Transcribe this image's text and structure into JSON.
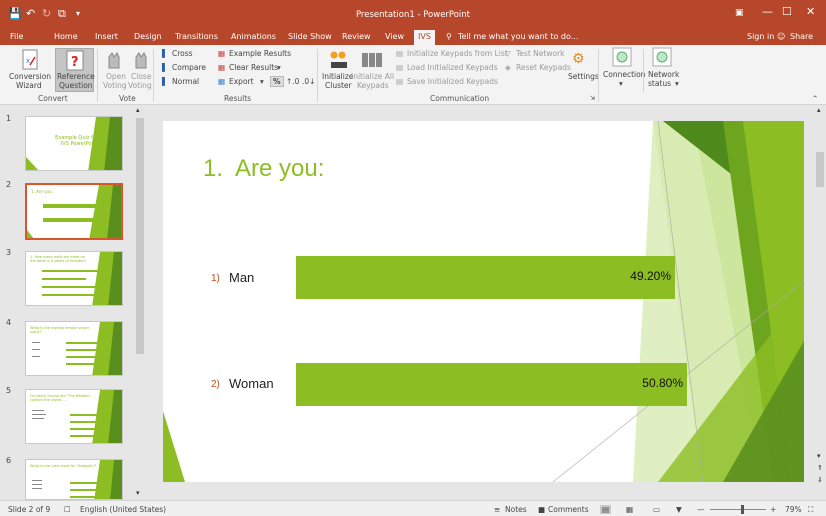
{
  "window": {
    "title": "Presentation1 - PowerPoint",
    "minimize": "—",
    "maximize": "☐",
    "close": "✕"
  },
  "quick_access": {
    "save_icon": "💾",
    "undo_icon": "↶",
    "redo_icon": "↻",
    "present_icon": "⧉",
    "customize_icon": "▾"
  },
  "tabs": [
    "File",
    "Home",
    "Insert",
    "Design",
    "Transitions",
    "Animations",
    "Slide Show",
    "Review",
    "View",
    "IVS"
  ],
  "tell_me": "Tell me what you want to do...",
  "account": {
    "sign_in": "Sign in",
    "share": "Share"
  },
  "ribbon": {
    "convert": {
      "group": "Convert",
      "conversion_wizard": [
        "Conversion",
        "Wizard"
      ],
      "reference_question": [
        "Reference",
        "Question"
      ]
    },
    "vote": {
      "group": "Vote",
      "open_voting": [
        "Open",
        "Voting"
      ],
      "close_voting": [
        "Close",
        "Voting"
      ]
    },
    "results": {
      "group": "Results",
      "cross": "Cross",
      "compare": "Compare",
      "normal": "Normal",
      "example_results": "Example Results",
      "clear_results": "Clear Results",
      "export": "Export",
      "percent": "%"
    },
    "communication": {
      "group": "Communication",
      "initialize_cluster": [
        "Initialize",
        "Cluster"
      ],
      "initialize_all_keypads": [
        "Initialize All",
        "Keypads"
      ],
      "init_keypads_from_list": "Initialize Keypads from List",
      "load_initialized_keypads": "Load Initialized Keypads",
      "save_initialized_keypads": "Save Initialized Keypads",
      "test_network": "Test Network",
      "reset_keypads": "Reset Keypads",
      "settings": "Settings"
    },
    "connection": {
      "connection": "Connection",
      "network_status": [
        "Network",
        "status"
      ]
    }
  },
  "thumbnails": [
    {
      "num": "1",
      "title": "Example Quiz for IVS PowerPoint"
    },
    {
      "num": "2",
      "title": "1. Are you:"
    },
    {
      "num": "3",
      "title": "1. How many balls are there on the table in a game of Snooker?"
    },
    {
      "num": "4",
      "title": "What is the highest female singer voice?"
    },
    {
      "num": "5",
      "title": "On which course did \"The Beatles\" contain the words ..."
    },
    {
      "num": "6",
      "title": "What is the Latin word for \"Seagulls\"?"
    }
  ],
  "slide": {
    "title": "1.  Are you:",
    "answers": [
      {
        "num": "1)",
        "label": "Man",
        "value": "49.20%"
      },
      {
        "num": "2)",
        "label": "Woman",
        "value": "50.80%"
      }
    ]
  },
  "chart_data": {
    "type": "bar",
    "categories": [
      "Man",
      "Woman"
    ],
    "values": [
      49.2,
      50.8
    ],
    "title": "1.  Are you:",
    "xlabel": "",
    "ylabel": "",
    "ylim": [
      0,
      100
    ],
    "colors": {
      "bar": "#8cbe23"
    }
  },
  "status": {
    "slide": "Slide 2 of 9",
    "language": "English (United States)",
    "notes": "Notes",
    "comments": "Comments",
    "zoom": "79%",
    "fit_icon": "⛶"
  },
  "colors": {
    "accent": "#b7472a",
    "green": "#8cbe23",
    "dark_green": "#5a8f1e"
  }
}
